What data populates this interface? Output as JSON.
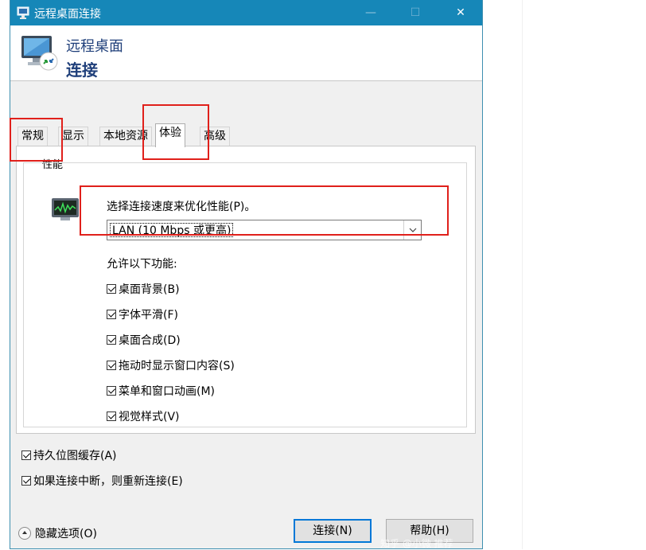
{
  "window": {
    "title": "远程桌面连接",
    "minimize_icon": "—",
    "maximize_icon": "☐",
    "close_icon": "✕"
  },
  "header": {
    "line1": "远程桌面",
    "line2": "连接"
  },
  "tabs": [
    {
      "label": "常规",
      "active": false
    },
    {
      "label": "显示",
      "active": false
    },
    {
      "label": "本地资源",
      "active": false
    },
    {
      "label": "体验",
      "active": true
    },
    {
      "label": "高级",
      "active": false
    }
  ],
  "performance": {
    "group_title": "性能",
    "speed_label": "选择连接速度来优化性能(P)。",
    "speed_value": "LAN (10 Mbps 或更高)",
    "allow_label": "允许以下功能:",
    "features": [
      {
        "label": "桌面背景(B)",
        "checked": true
      },
      {
        "label": "字体平滑(F)",
        "checked": true
      },
      {
        "label": "桌面合成(D)",
        "checked": true
      },
      {
        "label": "拖动时显示窗口内容(S)",
        "checked": true
      },
      {
        "label": "菜单和窗口动画(M)",
        "checked": true
      },
      {
        "label": "视觉样式(V)",
        "checked": true
      }
    ]
  },
  "options": [
    {
      "label": "持久位图缓存(A)",
      "checked": true
    },
    {
      "label": "如果连接中断，则重新连接(E)",
      "checked": true
    }
  ],
  "footer": {
    "hide_options": "隐藏选项(O)",
    "connect_button": "连接(N)",
    "help_button": "帮助(H)"
  },
  "watermark": "知乎 @小微 推荐",
  "colors": {
    "title_bar": "#1687b8",
    "highlight": "#e0201b",
    "header_text": "#1f3f7a",
    "default_button_border": "#0078d7"
  }
}
